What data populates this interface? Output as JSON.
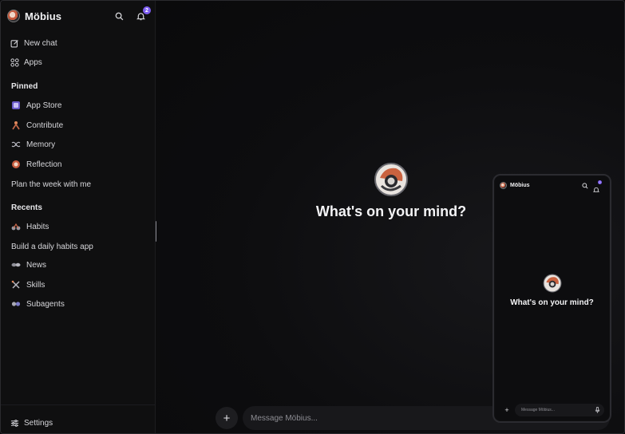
{
  "app": {
    "name": "Möbius",
    "notification_count": "2"
  },
  "sidebar": {
    "actions": [
      {
        "label": "New chat",
        "icon": "pencil-square-icon"
      },
      {
        "label": "Apps",
        "icon": "grid-icon"
      }
    ],
    "pinned_title": "Pinned",
    "pinned": [
      {
        "label": "App Store",
        "icon": "app-store-icon"
      },
      {
        "label": "Contribute",
        "icon": "contribute-icon"
      },
      {
        "label": "Memory",
        "icon": "memory-icon"
      },
      {
        "label": "Reflection",
        "icon": "reflection-icon"
      },
      {
        "label": "Plan the week with me"
      }
    ],
    "recents_title": "Recents",
    "recents": [
      {
        "label": "Habits",
        "icon": "habits-icon"
      },
      {
        "label": "Build a daily habits app"
      },
      {
        "label": "News",
        "icon": "news-icon"
      },
      {
        "label": "Skills",
        "icon": "skills-icon"
      },
      {
        "label": "Subagents",
        "icon": "subagents-icon"
      }
    ],
    "settings_label": "Settings"
  },
  "main": {
    "headline": "What's on your mind?",
    "composer_placeholder": "Message Möbius..."
  },
  "phone": {
    "name": "Möbius",
    "headline": "What's on your mind?",
    "composer_placeholder": "Message Möbius...",
    "notification_count": "2"
  },
  "colors": {
    "accent": "#7c5cf0",
    "background": "#0b0b0c",
    "sidebar": "#0f0f10"
  }
}
